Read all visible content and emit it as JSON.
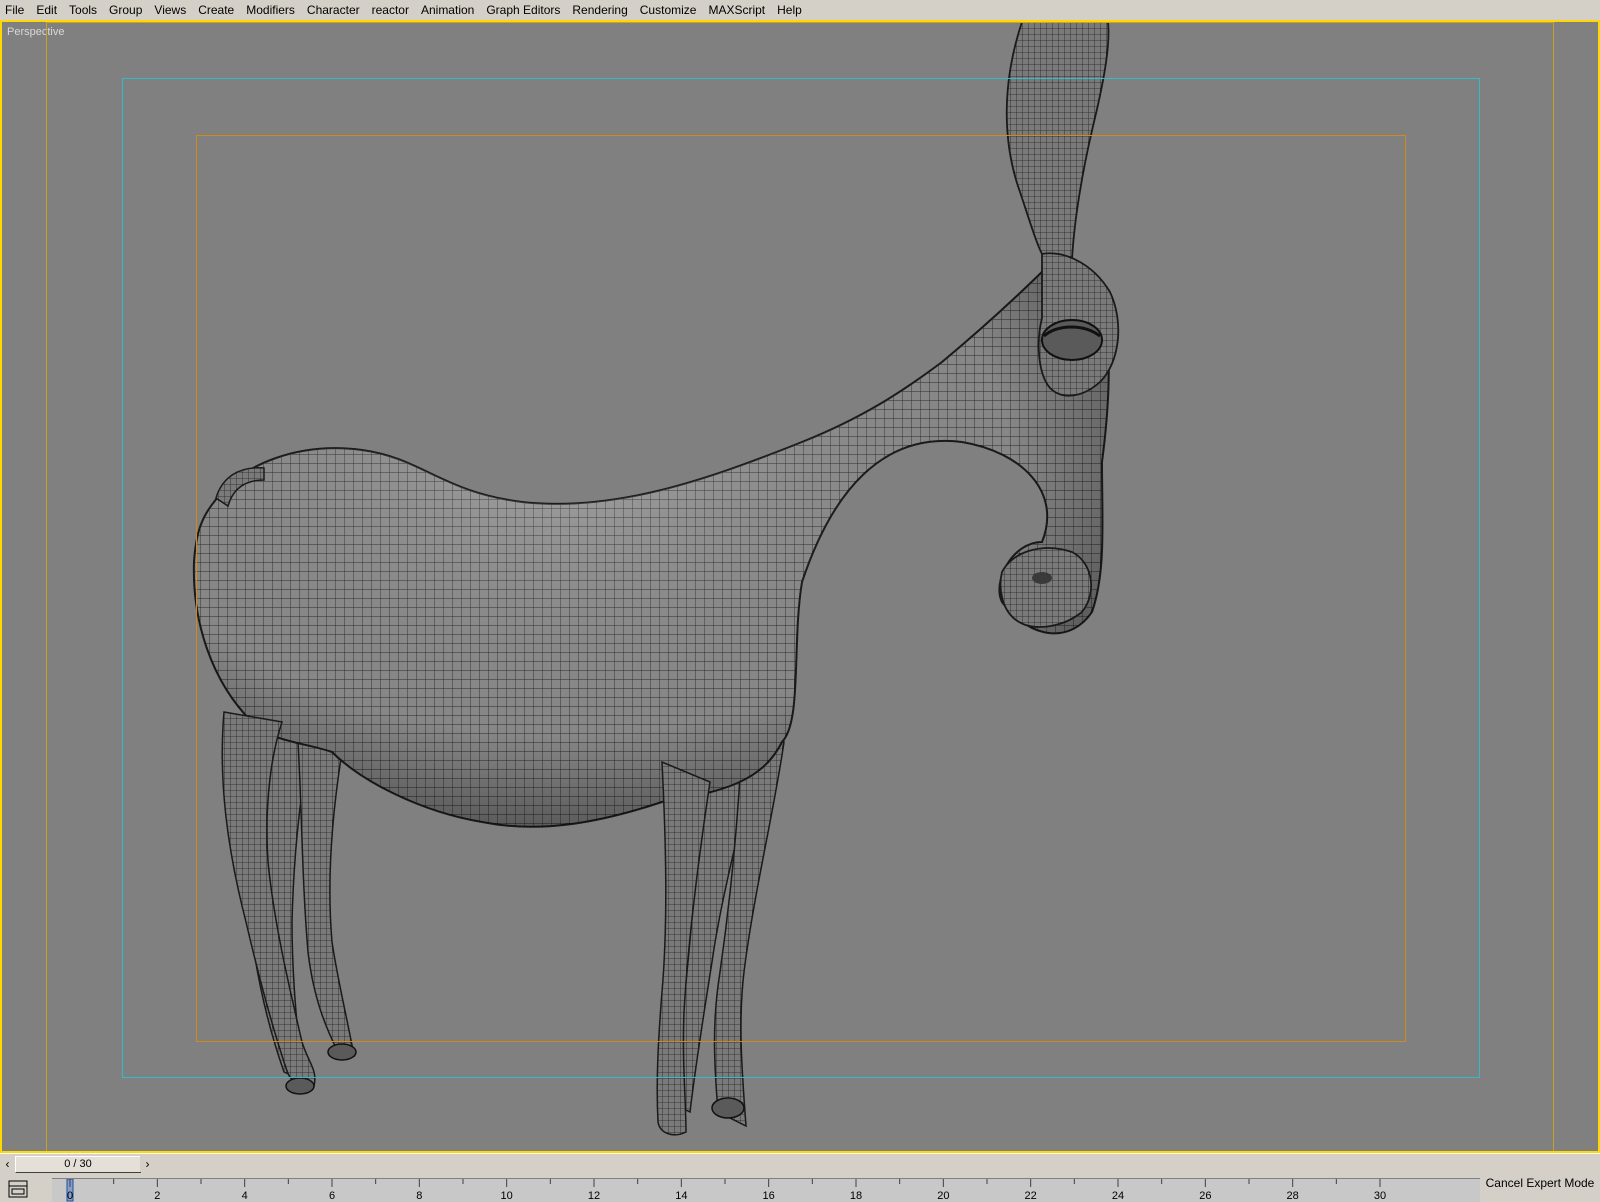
{
  "menubar": {
    "items": [
      "File",
      "Edit",
      "Tools",
      "Group",
      "Views",
      "Create",
      "Modifiers",
      "Character",
      "reactor",
      "Animation",
      "Graph Editors",
      "Rendering",
      "Customize",
      "MAXScript",
      "Help"
    ]
  },
  "viewport": {
    "label": "Perspective",
    "object_icon": "wireframe-donkey-model",
    "colors": {
      "background": "#808080",
      "active_border": "#ffd800",
      "safe_frame_live": "#c9a227",
      "safe_frame_action": "#38b9c9",
      "safe_frame_title": "#d08a1c"
    }
  },
  "timeline": {
    "slider_text": "0 / 30",
    "prev_icon": "arrow-left-icon",
    "next_icon": "arrow-right-icon",
    "current_frame": 0,
    "frame_end": 30,
    "ticks": [
      "0",
      "2",
      "4",
      "6",
      "8",
      "10",
      "12",
      "14",
      "16",
      "18",
      "20",
      "22",
      "24",
      "26",
      "28",
      "30"
    ],
    "expert_label": "Cancel Expert Mode"
  }
}
